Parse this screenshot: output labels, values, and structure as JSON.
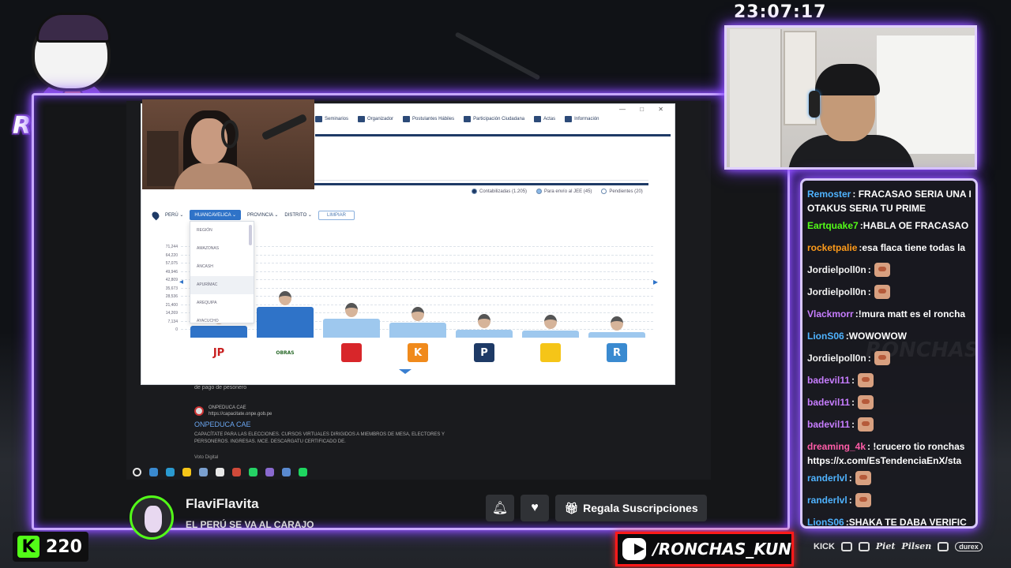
{
  "clock": "23:07:17",
  "logo": {
    "text": "RONCHAS"
  },
  "chat": {
    "messages": [
      {
        "user": "Remoster",
        "color": "#4fb3ff",
        "text": "FRACASAO SERIA UNA I",
        "continuation": "OTAKUS SERIA TU PRIME"
      },
      {
        "user": "Eartquake7",
        "color": "#53fc18",
        "text": "HABLA OE FRACASAO"
      },
      {
        "user": "rocketpalie",
        "color": "#ff9b1a",
        "text": "esa flaca tiene todas la"
      },
      {
        "user": "Jordielpoll0n",
        "color": "#f2f2f2",
        "text": "",
        "emote": true
      },
      {
        "user": "Jordielpoll0n",
        "color": "#f2f2f2",
        "text": "",
        "emote": true
      },
      {
        "user": "Vlackmorr",
        "color": "#c77dff",
        "text": "!mura matt es el roncha"
      },
      {
        "user": "LionS06",
        "color": "#4fb3ff",
        "text": "WOWOWOW"
      },
      {
        "user": "Jordielpoll0n",
        "color": "#f2f2f2",
        "text": "",
        "emote": true
      },
      {
        "user": "badevil11",
        "color": "#c77dff",
        "text": "",
        "emote": true
      },
      {
        "user": "badevil11",
        "color": "#c77dff",
        "text": "",
        "emote": true
      },
      {
        "user": "badevil11",
        "color": "#c77dff",
        "text": "",
        "emote": true
      },
      {
        "user": "dreaming_4k",
        "color": "#ff5ca8",
        "text": "!crucero tio ronchas",
        "continuation": "https://x.com/EsTendenciaEnX/sta"
      },
      {
        "user": "randerlvl",
        "color": "#4fb3ff",
        "text": "",
        "emote": true
      },
      {
        "user": "randerlvl",
        "color": "#4fb3ff",
        "text": "",
        "emote": true
      },
      {
        "user": "LionS06",
        "color": "#4fb3ff",
        "text": "SHAKA TE DABA VERIFIC"
      }
    ]
  },
  "browser": {
    "nav": [
      "Seminarios",
      "Organizador",
      "Postulantes Hábiles",
      "Participación Ciudadana",
      "Actas",
      "Información"
    ],
    "legend": [
      "Contabilizadas (1.205)",
      "Para envío al JEE (45)",
      "Pendientes (20)"
    ],
    "legend_colors": [
      "#1e3a66",
      "#8ab8e6",
      "#ffffff"
    ],
    "filters": {
      "country": "PERÚ",
      "selected": "HUANCAVELICA",
      "province": "PROVINCIA",
      "district": "DISTRITO",
      "clear": "LIMPIAR"
    },
    "dropdown": [
      "REGIÓN",
      "AMAZONAS",
      "ÁNCASH",
      "APURÍMAC",
      "AREQUIPA",
      "AYACUCHO"
    ],
    "y_ticks": [
      "71,244",
      "64,220",
      "57,075",
      "49,946",
      "42,809",
      "35,673",
      "28,536",
      "21,400",
      "14,269",
      "7,134",
      "0"
    ],
    "parties": [
      {
        "code": "JP",
        "bg": "#ffffff",
        "fg": "#c81e1e"
      },
      {
        "code": "OBRAS",
        "bg": "#ffffff",
        "fg": "#2a6a2a"
      },
      {
        "code": "",
        "bg": "#d8262a",
        "fg": "#ffffff"
      },
      {
        "code": "K",
        "bg": "#f08a1c",
        "fg": "#ffffff"
      },
      {
        "code": "P",
        "bg": "#1e3a66",
        "fg": "#ffffff"
      },
      {
        "code": "",
        "bg": "#f5c518",
        "fg": "#c81e1e"
      },
      {
        "code": "R",
        "bg": "#3a8ad0",
        "fg": "#ffffff"
      }
    ],
    "bar_levels": [
      0.14,
      0.35,
      0.22,
      0.17,
      0.09,
      0.08,
      0.06
    ]
  },
  "page_lower": {
    "note": "de pago de pesonero",
    "site_name": "ONPEDUCA CAE",
    "site_url": "https://capacitate.onpe.gob.pe",
    "title": "ONPEDUCA CAE",
    "desc": "CAPACÍTATE PARA LAS ELECCIONES. CURSOS VIRTUALES DIRIGIDOS A MIEMBROS DE MESA, ELECTORES Y PERSONEROS. INGRESAS. MCE. DESCARGATU CERTIFICADO DE.",
    "next": "Voto Digital"
  },
  "taskbar_colors": [
    "#e8e8e8",
    "#3a8ad0",
    "#2a9ad0",
    "#f5c518",
    "#7aa0d0",
    "#e8e8e8",
    "#d04a3a",
    "#25d366",
    "#8a6ad0",
    "#5a8ad0",
    "#1ed760"
  ],
  "streamer": {
    "name": "FlaviFlavita",
    "title": "EL PERÚ SE VA AL CARAJO",
    "gift_label": "Regala Suscripciones"
  },
  "kick_counter": {
    "logo": "K",
    "value": "220"
  },
  "youtube": {
    "handle": "/RONCHAS_KUN"
  },
  "sponsors": {
    "kick": "KICK",
    "piet": "Piet",
    "pilsen": "Pilsen",
    "durex": "durex"
  }
}
